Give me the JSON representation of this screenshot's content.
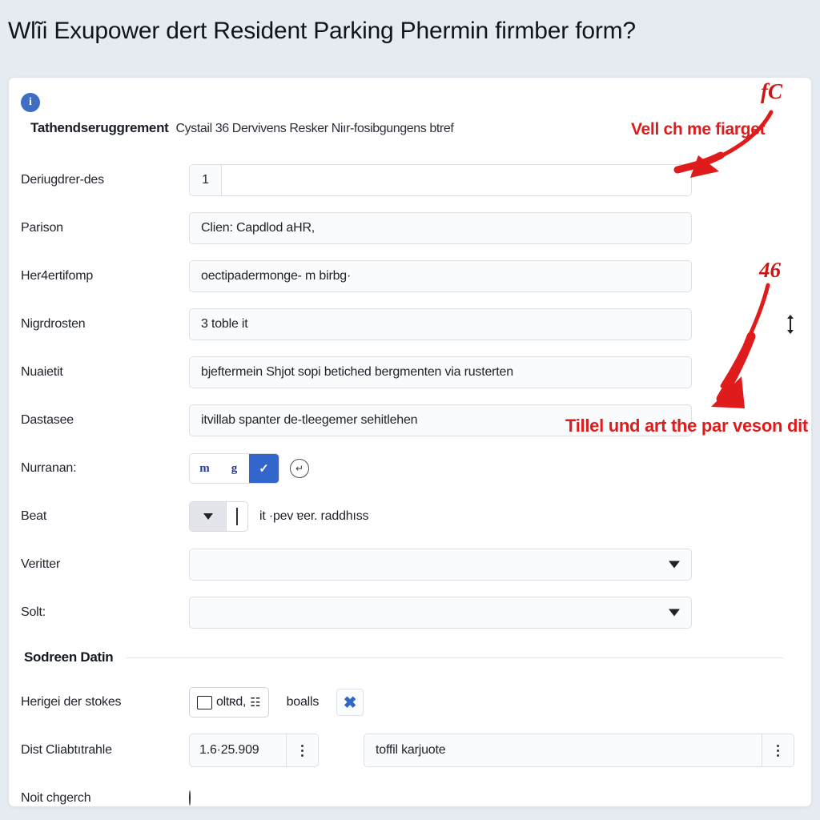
{
  "page": {
    "heading": "Wlĩi Exupower dert Resident Parking Phermin firmber form?",
    "bg_color": "#e6eaf1",
    "card_color": "#ffffff",
    "accent_color": "#3366cc",
    "annotation_color": "#e01b1b"
  },
  "card": {
    "info_icon": "i",
    "header_strong": "Tathendseruggrement",
    "header_sub": "Cystail 36 Dervivens Resker Niır-fosibgungens btref"
  },
  "fields": {
    "row1": {
      "label": "Deriugdrer-des",
      "number": "1",
      "value": ""
    },
    "row2": {
      "label": "Parison",
      "value": "Clien: Capdlod aHR,"
    },
    "row3": {
      "label": "Her4ertifomp",
      "value": "oectipadermonge- m birbg·"
    },
    "row4": {
      "label": "Nigrdrosten",
      "value": "3 toble it",
      "spinner": "stepper-icon"
    },
    "row5": {
      "label": "Nuaietit",
      "value": "bjeftermein Shjot sopi betiched bergmenten via rusterten"
    },
    "row6": {
      "label": "Dastasee",
      "value": "itvillab spanter de-tleegemer sehitlehen"
    },
    "row7": {
      "label": "Nurranan:",
      "buttons": [
        {
          "name": "bold-italic-button",
          "glyph": "m",
          "selected": false
        },
        {
          "name": "underline-button",
          "glyph": "g",
          "selected": false
        },
        {
          "name": "pen-button",
          "glyph": "✓",
          "selected": true
        }
      ],
      "extra_icon": "undo-icon",
      "extra_glyph": "↵"
    },
    "row8": {
      "label": "Beat",
      "arrow": "▼",
      "text": "it ·pev ɐer. raddhıss"
    },
    "row9": {
      "label": "Veritter",
      "value": "",
      "caret": "▼"
    },
    "row10": {
      "label": "Solt:",
      "value": "",
      "caret": "▼"
    }
  },
  "section": {
    "title": "Sodreen Datin"
  },
  "bottom": {
    "row_checkbox": {
      "label": "Herigei der stokes",
      "checkbox_text": "oltʀd,",
      "checkbox_glyph": "☷",
      "after_text": "boalls",
      "close_glyph": "✖"
    },
    "row_numeric": {
      "label": "Dist Cliabtıtrahle",
      "number": "1.6·25.909",
      "kebab": "more-options-icon",
      "text": "toffil karjuote",
      "kebab2": "more-options-icon"
    },
    "row_radio": {
      "label": "Noit chgerch",
      "state": "unchecked"
    }
  },
  "annotations": {
    "note1": "Vell ch me fiarget",
    "note2": "Tillel und art the par veson dit",
    "marker1": "fC",
    "marker2": "46"
  }
}
